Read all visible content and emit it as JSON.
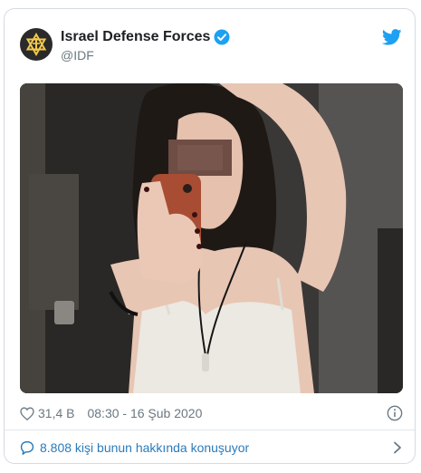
{
  "author": {
    "display_name": "Israel Defense Forces",
    "handle": "@IDF",
    "verified": true
  },
  "icons": {
    "avatar": "idf-emblem-icon",
    "verified": "verified-badge-icon",
    "brand": "twitter-bird-icon",
    "like": "heart-outline-icon",
    "info": "info-icon",
    "conversation": "speech-bubble-icon",
    "chevron": "chevron-right-icon"
  },
  "stats": {
    "likes": "31,4 B",
    "timestamp": "08:30 - 16 Şub 2020"
  },
  "conversation": {
    "label": "8.808 kişi bunun hakkında konuşuyor"
  },
  "colors": {
    "accent": "#1da1f2",
    "link": "#2b7bb9",
    "muted": "#697882",
    "text": "#1c2022",
    "border": "#d4dbe1"
  }
}
